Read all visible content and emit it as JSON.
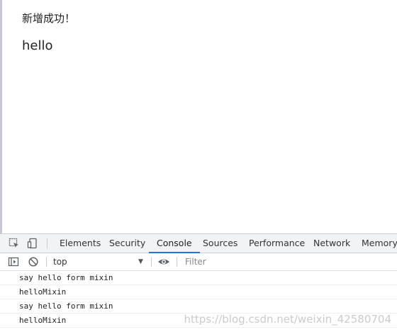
{
  "page": {
    "notice": "新增成功！",
    "hello": "hello"
  },
  "devtools": {
    "tabs": [
      {
        "label": "Elements"
      },
      {
        "label": "Security"
      },
      {
        "label": "Console",
        "active": true
      },
      {
        "label": "Sources"
      },
      {
        "label": "Performance"
      },
      {
        "label": "Network"
      },
      {
        "label": "Memory"
      }
    ],
    "toolbar": {
      "context": "top",
      "filter_placeholder": "Filter"
    },
    "console_logs": [
      "say hello form mixin",
      "helloMixin",
      "say hello form mixin",
      "helloMixin"
    ],
    "accent": "#1a73e8"
  },
  "watermark": "https://blog.csdn.net/weixin_42580704",
  "icons": [
    "inspect-element-icon",
    "device-toggle-icon",
    "sidebar-toggle-icon",
    "clear-console-icon",
    "dropdown-arrow-icon",
    "eye-icon"
  ]
}
